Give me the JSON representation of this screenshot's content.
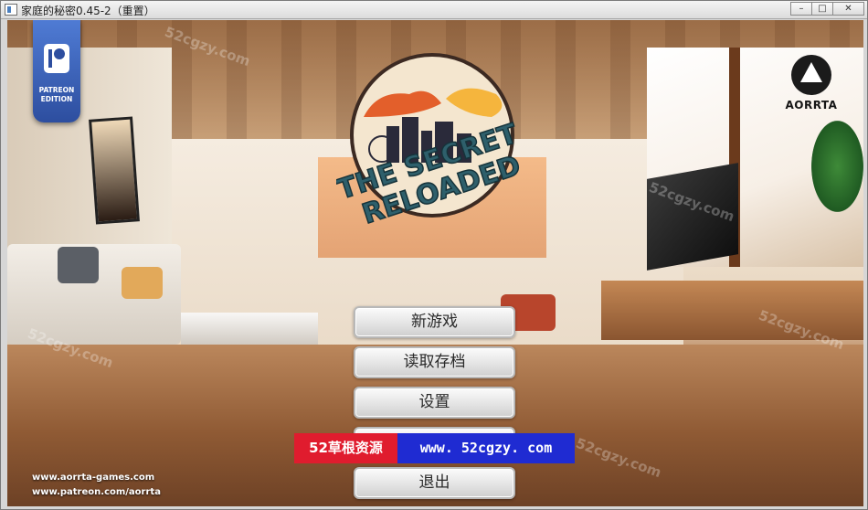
{
  "window": {
    "title": "家庭的秘密0.45-2（重置）",
    "controls": {
      "minimize": "–",
      "maximize": "□",
      "close": "✕"
    }
  },
  "branding": {
    "patreon_badge": "PATREON EDITION",
    "studio_logo": "AORRTA",
    "game_title": [
      "THE SECRET",
      "RELOADED"
    ]
  },
  "menu": {
    "items": [
      {
        "key": "new_game",
        "label": "新游戏"
      },
      {
        "key": "load",
        "label": "读取存档"
      },
      {
        "key": "settings",
        "label": "设置"
      },
      {
        "key": "exit",
        "label": "退出"
      }
    ]
  },
  "watermark_banner": {
    "left_text": "52草根资源",
    "right_text": "www. 52cgzy. com",
    "faint_mark": "52cgzy.com"
  },
  "links": {
    "website": "www.aorrta-games.com",
    "patreon": "www.patreon.com/aorrta"
  },
  "colors": {
    "banner_red": "#e01c2e",
    "banner_blue": "#1f2bd2",
    "patreon_blue": "#2d4e9f"
  }
}
